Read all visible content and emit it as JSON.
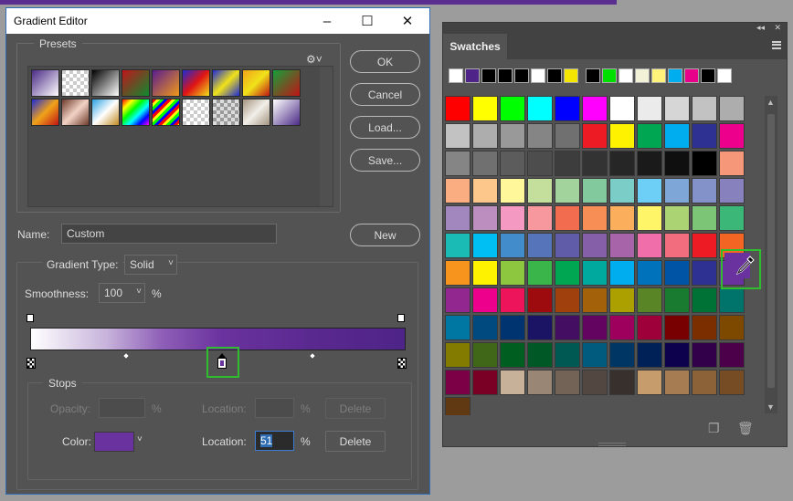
{
  "dialog": {
    "title": "Gradient Editor",
    "presets_label": "Presets",
    "gear_icon": "gear-icon",
    "presets": [
      "linear-gradient(135deg,#4a2a86,#ffffff)",
      "repeating-conic-gradient(#ffffff 0 25%,#cccccc 0 50%) 0 0/8px 8px",
      "linear-gradient(135deg,#000000,#ffffff)",
      "linear-gradient(135deg,#c0151b,#0f8a2e)",
      "linear-gradient(135deg,#5a1c8f,#f09a1a)",
      "linear-gradient(135deg,#1d2bd6,#e01414,#f0e21a)",
      "linear-gradient(135deg,#1d2bd6,#f0e21a,#1d2bd6)",
      "linear-gradient(135deg,#f0a21a,#f0e21a,#c01414)",
      "linear-gradient(135deg,#15a03a,#c01414)",
      "linear-gradient(135deg,#1d2bd6,#f0a21a,#c01414)",
      "linear-gradient(135deg,#6e3a2a,#f2d3c6,#6e3a2a)",
      "linear-gradient(135deg,#2aa0e0,#ffffff,#c08a20)",
      "linear-gradient(135deg,#ff0000,#ffff00,#00ff00,#00ffff,#0000ff,#ff00ff)",
      "repeating-linear-gradient(135deg,#ff0000 0 3px,#ffff00 3px 6px,#00ff00 6px 9px,#0000ff 9px 12px)",
      "repeating-conic-gradient(#ffffff 0 25%,#cccccc 0 50%) 0 0/8px 8px",
      "repeating-conic-gradient(#999999 0 25%,#dddddd 0 50%) 0 0/8px 8px",
      "linear-gradient(135deg,#a49480,#f2efe9,#a49480)",
      "linear-gradient(135deg,#ffffff,#4a2a86)"
    ],
    "buttons": {
      "ok": "OK",
      "cancel": "Cancel",
      "load": "Load...",
      "save": "Save...",
      "new": "New"
    },
    "name_label": "Name:",
    "name_value": "Custom",
    "gradient_type_label": "Gradient Type:",
    "gradient_type_value": "Solid",
    "smoothness_label": "Smoothness:",
    "smoothness_value": "100",
    "percent": "%",
    "gradient_colors": {
      "start": "#ffffff",
      "mid": "#6a329e",
      "end": "#4e2488"
    },
    "stops": {
      "label": "Stops",
      "opacity_label": "Opacity:",
      "opacity_value": "",
      "location_label": "Location:",
      "opacity_location_value": "",
      "delete_label": "Delete",
      "color_label": "Color:",
      "color_value": "#6a329e",
      "color_location_selected": "51",
      "color_location_value": ""
    }
  },
  "swatches_panel": {
    "tab": "Swatches",
    "recent": [
      "#ffffff",
      "#4e2488",
      "#000000",
      "#000000",
      "#000000",
      "#ffffff",
      "#000000",
      "#f5e600",
      "#000000",
      "#00e000",
      "#ffffff",
      "#f2f2d8",
      "#fff27a",
      "#00aef0",
      "#e8008a",
      "#000000",
      "#ffffff"
    ],
    "swatches": [
      "#ff0000",
      "#ffff00",
      "#00ff00",
      "#00ffff",
      "#0000ff",
      "#ff00ff",
      "#ffffff",
      "#ebebeb",
      "#d6d6d6",
      "#c2c2c2",
      "#adadad",
      "#c2c2c2",
      "#adadad",
      "#999999",
      "#858585",
      "#707070",
      "#ed1c24",
      "#fff200",
      "#00a651",
      "#00aeef",
      "#2e3192",
      "#ec008c",
      "#858585",
      "#707070",
      "#5c5c5c",
      "#4d4d4d",
      "#3d3d3d",
      "#333333",
      "#262626",
      "#1a1a1a",
      "#0f0f0f",
      "#000000",
      "#f7977a",
      "#f9ad81",
      "#fdc68a",
      "#fff79a",
      "#c4df9b",
      "#a3d39c",
      "#82ca9d",
      "#7bcdc8",
      "#6ecff6",
      "#7ea7d8",
      "#8393ca",
      "#8781bd",
      "#a187be",
      "#bc8dbf",
      "#f49ac2",
      "#f6989d",
      "#f26c4f",
      "#f68e56",
      "#fbaf5d",
      "#fff568",
      "#acd373",
      "#7cc576",
      "#3bb878",
      "#1abbb4",
      "#00bff3",
      "#438ccb",
      "#5574b9",
      "#605ca8",
      "#855fa8",
      "#a864a8",
      "#f06eaa",
      "#f26d7d",
      "#ed1c24",
      "#f26522",
      "#f7941d",
      "#fff200",
      "#8dc63f",
      "#39b54a",
      "#00a651",
      "#00a99d",
      "#00aeef",
      "#0072bc",
      "#0054a6",
      "#2e3192",
      "#6a329e",
      "#92278f",
      "#ec008c",
      "#ed145b",
      "#9e0b0f",
      "#a0410d",
      "#a36209",
      "#aba000",
      "#598527",
      "#197b30",
      "#007236",
      "#00746b",
      "#0076a3",
      "#004a80",
      "#003471",
      "#1b1464",
      "#440e62",
      "#630460",
      "#9e005d",
      "#9e0039",
      "#790000",
      "#7b2e00",
      "#7d4900",
      "#827b00",
      "#406618",
      "#005e20",
      "#005826",
      "#005952",
      "#005b7f",
      "#003663",
      "#002157",
      "#0d004c",
      "#32004b",
      "#4b0049",
      "#7b0046",
      "#7a0026",
      "#c7b299",
      "#998675",
      "#736357",
      "#534741",
      "#37302d",
      "#c69c6d",
      "#a67c52",
      "#8c6239",
      "#754c24",
      "#603913"
    ]
  }
}
